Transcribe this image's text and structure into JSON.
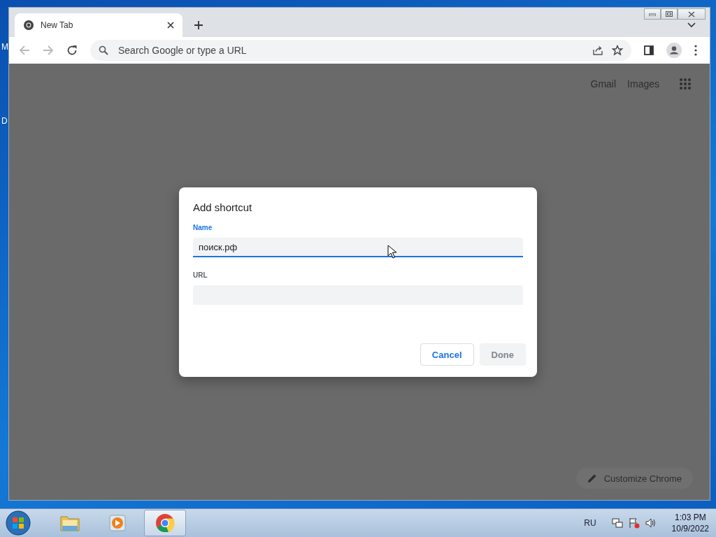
{
  "desktop": {
    "icon_labels": [
      "M",
      "D"
    ]
  },
  "browser": {
    "tabs": [
      {
        "title": "New Tab",
        "selected": true
      }
    ],
    "address_bar": {
      "placeholder": "Search Google or type a URL"
    },
    "page": {
      "links": [
        "Gmail",
        "Images"
      ],
      "customize_button": "Customize Chrome"
    }
  },
  "dialog": {
    "title": "Add shortcut",
    "fields": [
      {
        "label": "Name",
        "value": "поиск.рф",
        "focused": true
      },
      {
        "label": "URL",
        "focused": false
      }
    ],
    "buttons": [
      {
        "label": "Cancel",
        "disabled": false
      },
      {
        "label": "Done",
        "disabled": true
      }
    ]
  },
  "taskbar": {
    "apps": [
      {
        "kind": "explorer",
        "selected": false
      },
      {
        "kind": "media",
        "selected": false
      },
      {
        "kind": "chrome",
        "selected": true
      }
    ],
    "language": "RU",
    "time": "1:03 PM",
    "date": "10/9/2022"
  }
}
